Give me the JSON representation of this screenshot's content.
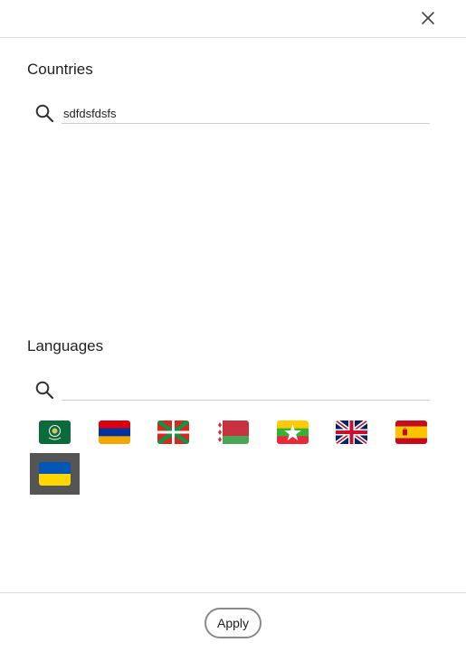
{
  "header": {
    "close_icon": "close-icon"
  },
  "countries": {
    "title": "Countries",
    "search": {
      "value": "sdfdsfdsfs",
      "placeholder": "",
      "icon": "search-icon"
    }
  },
  "languages": {
    "title": "Languages",
    "search": {
      "value": "",
      "placeholder": "",
      "icon": "search-icon"
    },
    "flags": [
      {
        "icon": "arab-league-flag-icon",
        "selected": false
      },
      {
        "icon": "armenia-flag-icon",
        "selected": false
      },
      {
        "icon": "basque-flag-icon",
        "selected": false
      },
      {
        "icon": "belarus-flag-icon",
        "selected": false
      },
      {
        "icon": "myanmar-flag-icon",
        "selected": false
      },
      {
        "icon": "united-kingdom-flag-icon",
        "selected": false
      },
      {
        "icon": "spain-flag-icon",
        "selected": false
      },
      {
        "icon": "ukraine-flag-icon",
        "selected": true
      }
    ]
  },
  "footer": {
    "apply_label": "Apply"
  },
  "colors": {
    "selected_bg": "#555555",
    "divider": "#dcdcdc",
    "button_border": "#8a8a8a"
  }
}
